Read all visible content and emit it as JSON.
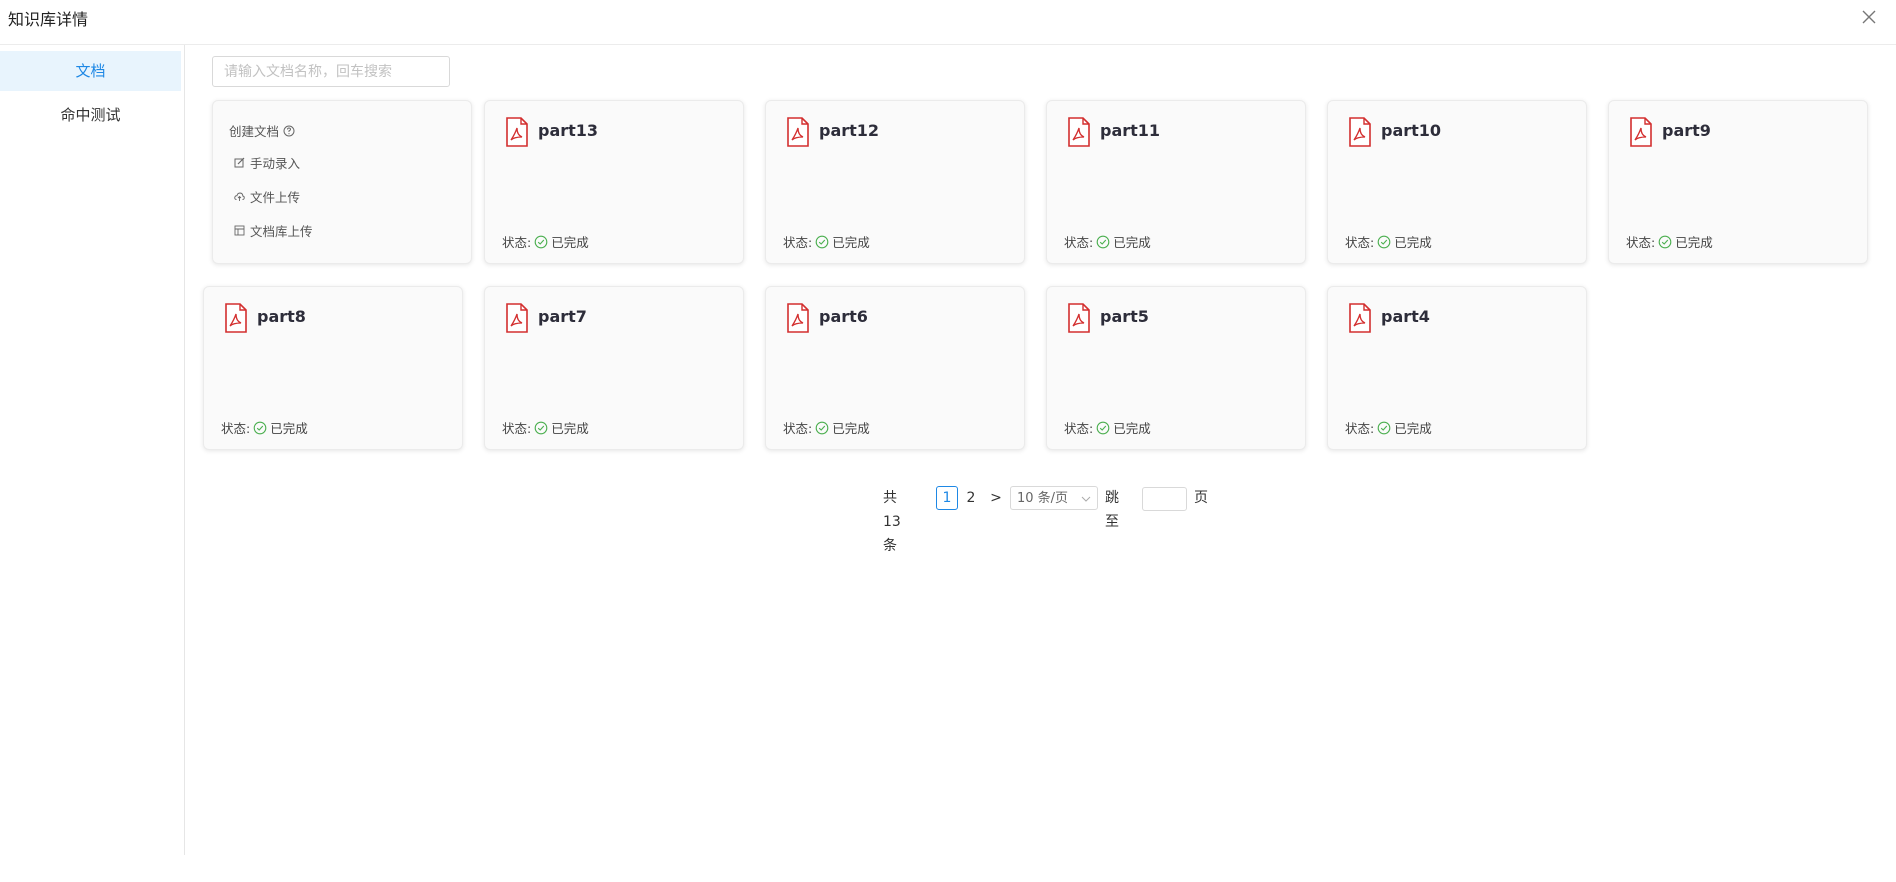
{
  "dialog": {
    "title": "知识库详情",
    "close_icon": "close-icon"
  },
  "sidebar": {
    "items": [
      {
        "label": "文档",
        "active": true
      },
      {
        "label": "命中测试",
        "active": false
      }
    ]
  },
  "search": {
    "placeholder": "请输入文档名称，回车搜索",
    "value": ""
  },
  "create": {
    "title": "创建文档",
    "help_icon": "question-circle-icon",
    "options": [
      {
        "label": "手动录入",
        "icon": "edit-icon"
      },
      {
        "label": "文件上传",
        "icon": "cloud-upload-icon"
      },
      {
        "label": "文档库上传",
        "icon": "library-icon"
      }
    ]
  },
  "status_prefix": "状态:",
  "documents": [
    {
      "name": "part13",
      "status": "已完成",
      "icon": "pdf-file-icon"
    },
    {
      "name": "part12",
      "status": "已完成",
      "icon": "pdf-file-icon"
    },
    {
      "name": "part11",
      "status": "已完成",
      "icon": "pdf-file-icon"
    },
    {
      "name": "part10",
      "status": "已完成",
      "icon": "pdf-file-icon"
    },
    {
      "name": "part9",
      "status": "已完成",
      "icon": "pdf-file-icon"
    },
    {
      "name": "part8",
      "status": "已完成",
      "icon": "pdf-file-icon"
    },
    {
      "name": "part7",
      "status": "已完成",
      "icon": "pdf-file-icon"
    },
    {
      "name": "part6",
      "status": "已完成",
      "icon": "pdf-file-icon"
    },
    {
      "name": "part5",
      "status": "已完成",
      "icon": "pdf-file-icon"
    },
    {
      "name": "part4",
      "status": "已完成",
      "icon": "pdf-file-icon"
    }
  ],
  "pagination": {
    "total": "共13条",
    "pages": [
      "1",
      "2"
    ],
    "current": "1",
    "next": ">",
    "page_size": "10 条/页",
    "jump_label": "跳至",
    "jump_suffix": "页"
  },
  "colors": {
    "accent": "#1e88e5",
    "pdf": "#d32f2f",
    "success": "#4caf50"
  }
}
